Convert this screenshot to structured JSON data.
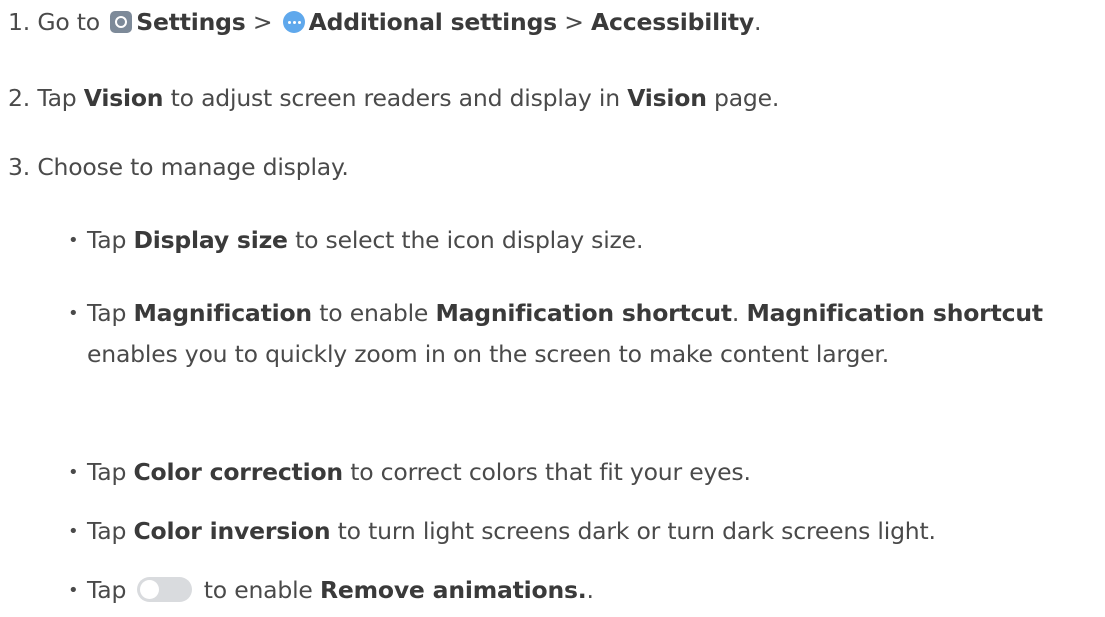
{
  "steps": {
    "s1": {
      "num": "1.",
      "t1": "Go to",
      "settings": "Settings",
      "sep1": ">",
      "additional": "Additional settings",
      "sep2": ">",
      "accessibility": "Accessibility",
      "end": "."
    },
    "s2": {
      "num": "2.",
      "t1": "Tap",
      "vision": "Vision",
      "t2": "to adjust screen readers and display in",
      "vision2": "Vision",
      "t3": "page."
    },
    "s3": {
      "num": "3.",
      "text": "Choose to manage display."
    }
  },
  "bullets": {
    "b1": {
      "t1": "Tap",
      "bold": "Display size",
      "t2": "to select the icon display size."
    },
    "b2": {
      "t1": "Tap",
      "bold1": "Magnification",
      "t2": "to enable",
      "bold2": "Magnification shortcut",
      "t3": ".",
      "bold3": "Magnification shortcut",
      "t4": "enables you to quickly zoom in on the screen to make content larger."
    },
    "b3": {
      "t1": "Tap",
      "bold": "Color correction",
      "t2": "to correct colors that fit your eyes."
    },
    "b4": {
      "t1": "Tap",
      "bold": "Color inversion",
      "t2": "to turn light screens dark or turn dark screens light."
    },
    "b5": {
      "t1": "Tap",
      "t2": "to enable",
      "bold": "Remove animations.",
      "end": "."
    }
  },
  "bullet_char": "•",
  "icons": {
    "settings": "settings-gear-icon",
    "additional": "more-dots-icon",
    "toggle": "toggle-switch-off-icon"
  },
  "colors": {
    "text": "#4a4a4a",
    "settings_icon": "#7d8a99",
    "more_icon": "#5fa8ec",
    "toggle_track": "#d9dbde"
  }
}
